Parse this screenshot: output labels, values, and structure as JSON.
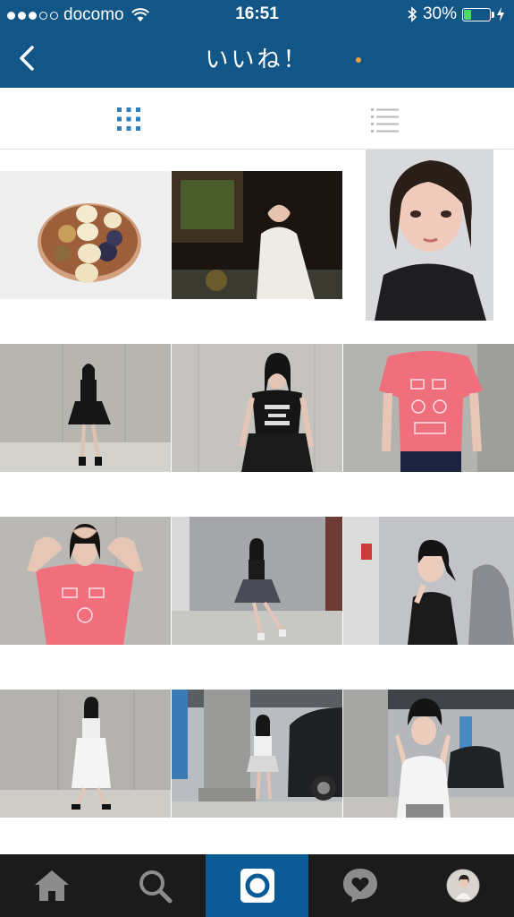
{
  "status_bar": {
    "carrier": "docomo",
    "time": "16:51",
    "battery_percent": "30%",
    "battery_level": 0.3,
    "signal_dots_filled": 3,
    "signal_dots_total": 5
  },
  "nav": {
    "title": "いいね！"
  },
  "view_toggle": {
    "active": "grid"
  },
  "grid_rows": [
    [
      "acai-bowl",
      "girl-white-coat-dinner",
      "selfie-black-top"
    ],
    [
      "standing-black-skirt-wall",
      "born-to-be-free-tee",
      "pink-tee-closeup"
    ],
    [
      "heart-hands-pink-tee",
      "parking-garage-pose",
      "side-profile-ponytail"
    ],
    [
      "white-skirt-wall",
      "pillar-parking-lot",
      "peace-sign-hat"
    ]
  ],
  "tabbar": {
    "items": [
      "home",
      "search",
      "camera",
      "activity",
      "profile"
    ],
    "active": "camera"
  },
  "colors": {
    "brand_blue": "#125688",
    "active_tab_blue": "#0c5a95",
    "toggle_blue": "#2e7fbf",
    "tabbar_bg": "#1b1b1b"
  }
}
